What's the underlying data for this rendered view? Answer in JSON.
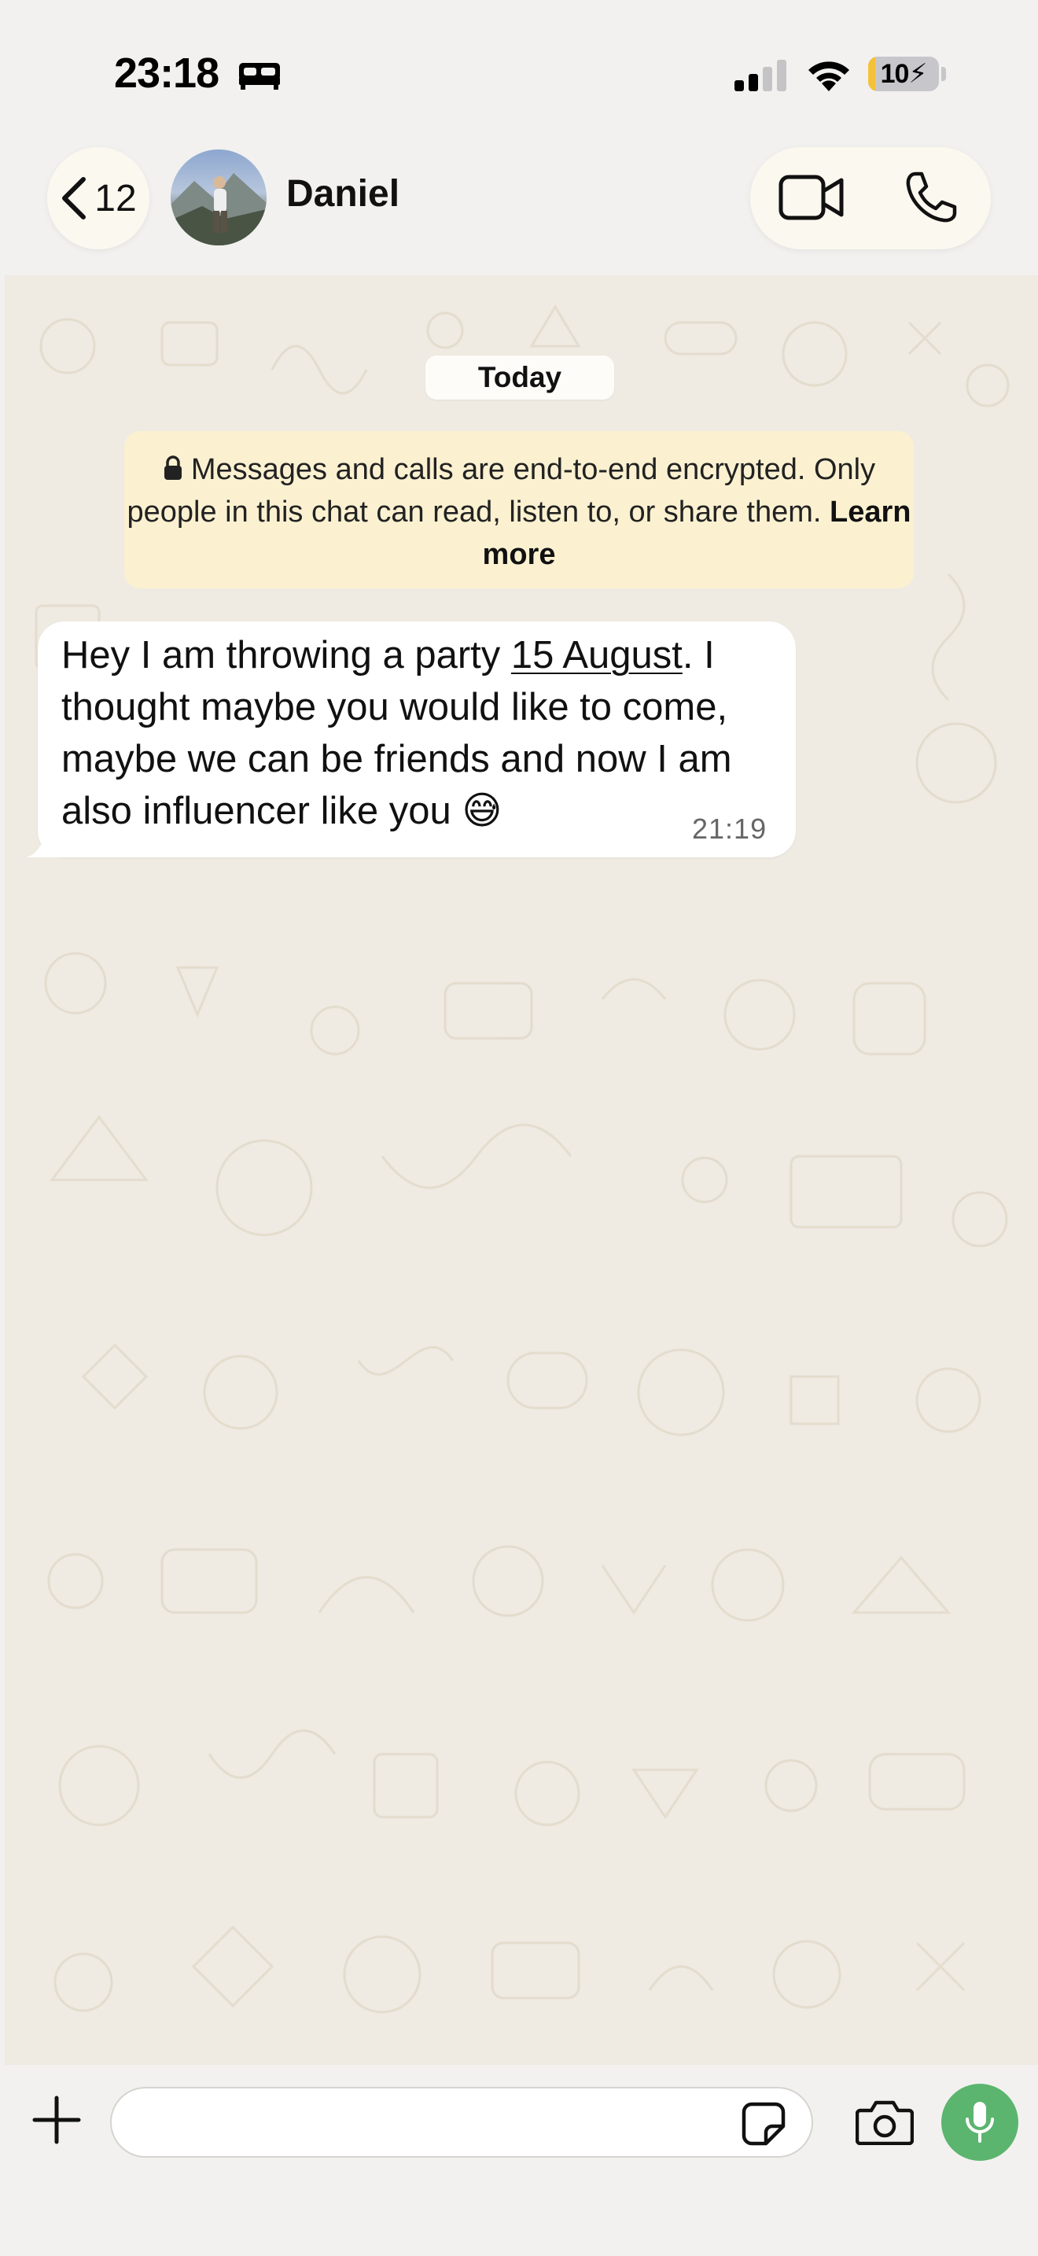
{
  "status_bar": {
    "time": "23:18",
    "battery_percent": "10",
    "battery_level": 0.1,
    "icons": [
      "bed-icon",
      "cellular-signal-icon",
      "wifi-icon",
      "battery-charging-icon"
    ]
  },
  "header": {
    "back_count": "12",
    "contact_name": "Daniel",
    "icons": [
      "chevron-left-icon",
      "video-call-icon",
      "phone-icon"
    ]
  },
  "chat": {
    "date_chip": "Today",
    "encryption_notice": {
      "text": "Messages and calls are end-to-end encrypted. Only people in this chat can read, listen to, or share them.",
      "link": "Learn more"
    },
    "messages": [
      {
        "direction": "incoming",
        "text_before_link": "Hey I am throwing a party ",
        "link_text": "15 August",
        "text_after_link": ". I thought maybe you would like to come, maybe we can be friends and now I am also influencer like you 😅",
        "time": "21:19"
      }
    ]
  },
  "input_bar": {
    "value": "",
    "placeholder": "",
    "icons": [
      "plus-icon",
      "sticker-icon",
      "camera-icon",
      "microphone-icon"
    ]
  },
  "colors": {
    "chat_background": "#efeae2",
    "notice_background": "#fbf1d1",
    "mic_button": "#5bb56e",
    "battery_fill": "#f4c23a"
  }
}
